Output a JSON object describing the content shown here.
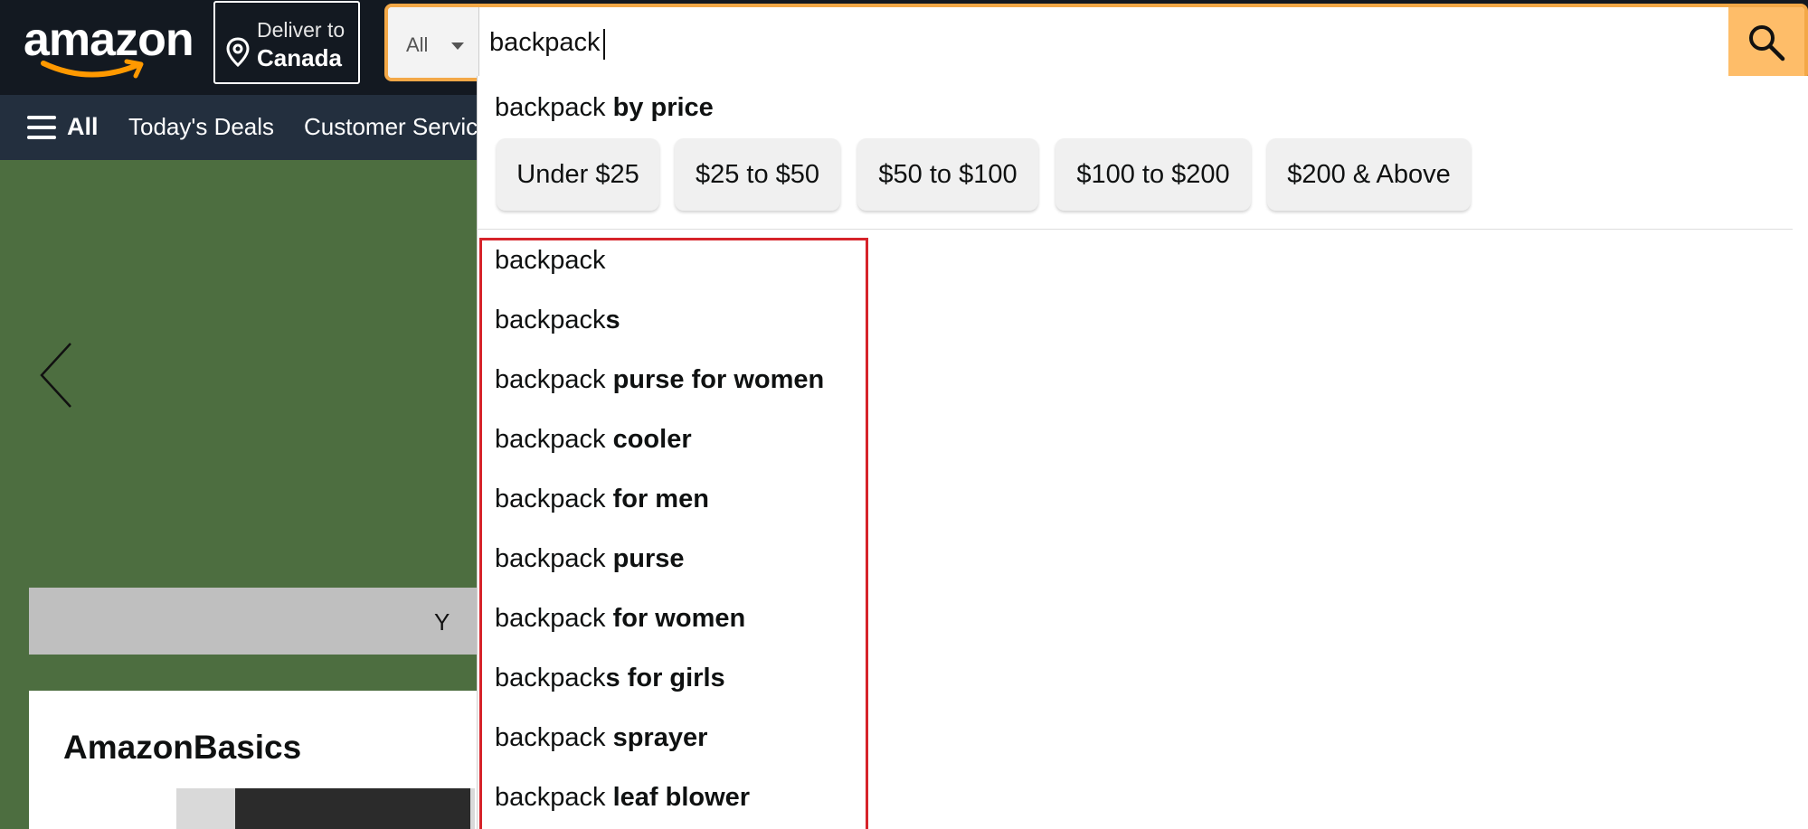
{
  "header": {
    "logo_text": "amazon",
    "deliver_line1": "Deliver to",
    "deliver_line2": "Canada",
    "search_category": "All",
    "search_value": "backpack"
  },
  "nav": {
    "all_label": "All",
    "todays_deals": "Today's Deals",
    "customer_service": "Customer Servic"
  },
  "hero": {
    "notice_fragment": "Y",
    "card_title": "AmazonBasics"
  },
  "dropdown": {
    "price_heading_prefix": "backpack",
    "price_heading_suffix": "by price",
    "price_chips": [
      "Under $25",
      "$25 to $50",
      "$50 to $100",
      "$100 to $200",
      "$200 & Above"
    ],
    "suggestions": [
      {
        "prefix": "backpack",
        "suffix": ""
      },
      {
        "prefix": "backpack",
        "suffix": "s"
      },
      {
        "prefix": "backpack ",
        "suffix": "purse for women"
      },
      {
        "prefix": "backpack ",
        "suffix": "cooler"
      },
      {
        "prefix": "backpack ",
        "suffix": "for men"
      },
      {
        "prefix": "backpack ",
        "suffix": "purse"
      },
      {
        "prefix": "backpack ",
        "suffix": "for women"
      },
      {
        "prefix": "backpack",
        "suffix": "s for girls"
      },
      {
        "prefix": "backpack ",
        "suffix": "sprayer"
      },
      {
        "prefix": "backpack ",
        "suffix": "leaf blower"
      }
    ]
  },
  "colors": {
    "header_bg": "#131921",
    "nav_bg": "#232f3e",
    "search_accent": "#febd69",
    "highlight_border": "#d6232a"
  },
  "icons": [
    "amazon-smile-logo",
    "location-pin-icon",
    "dropdown-caret-icon",
    "search-icon",
    "hamburger-icon",
    "chevron-left-icon"
  ]
}
